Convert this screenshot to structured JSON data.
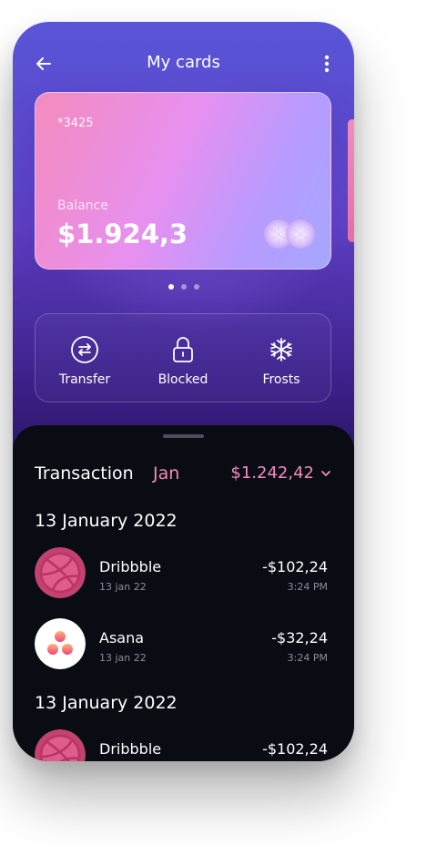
{
  "header": {
    "title": "My cards"
  },
  "card": {
    "number": "*3425",
    "balance_label": "Balance",
    "balance": "$1.924,3"
  },
  "pager": {
    "count": 3,
    "active_index": 0
  },
  "actions": [
    {
      "label": "Transfer",
      "icon": "transfer-icon"
    },
    {
      "label": "Blocked",
      "icon": "lock-icon"
    },
    {
      "label": "Frosts",
      "icon": "snowflake-icon"
    }
  ],
  "transactions": {
    "title": "Transaction",
    "month": "Jan",
    "total": "$1.242,42",
    "groups": [
      {
        "date": "13 January 2022",
        "items": [
          {
            "name": "Dribbble",
            "date": "13 jan 22",
            "amount": "-$102,24",
            "time": "3:24 PM",
            "icon": "dribbble-icon"
          },
          {
            "name": "Asana",
            "date": "13 jan 22",
            "amount": "-$32,24",
            "time": "3:24 PM",
            "icon": "asana-icon"
          }
        ]
      },
      {
        "date": "13 January 2022",
        "items": [
          {
            "name": "Dribbble",
            "amount": "-$102,24",
            "icon": "dribbble-icon"
          }
        ]
      }
    ]
  },
  "colors": {
    "accent_pink": "#f28bbd",
    "sheet_bg": "#0a0c14",
    "card_gradient_start": "#f38bbd",
    "card_gradient_end": "#a4a7ff"
  }
}
